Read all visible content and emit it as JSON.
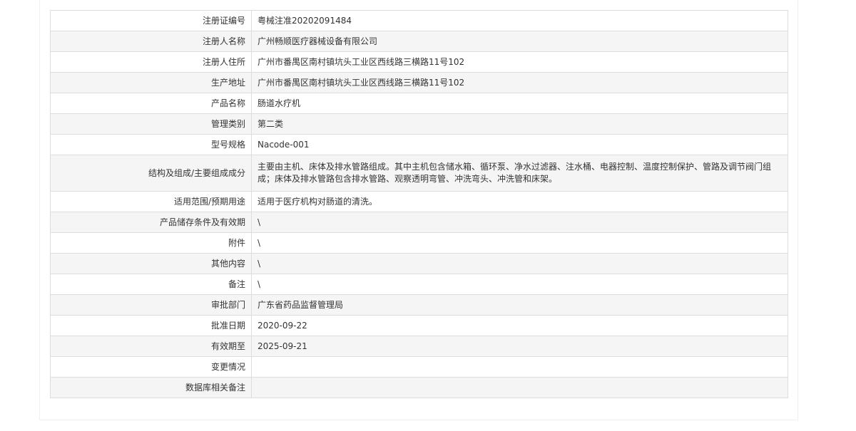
{
  "rows": [
    {
      "label": "注册证编号",
      "value": "粤械注准20202091484"
    },
    {
      "label": "注册人名称",
      "value": "广州畅顺医疗器械设备有限公司"
    },
    {
      "label": "注册人住所",
      "value": "广州市番禺区南村镇坑头工业区西线路三横路11号102"
    },
    {
      "label": "生产地址",
      "value": "广州市番禺区南村镇坑头工业区西线路三横路11号102"
    },
    {
      "label": "产品名称",
      "value": "肠道水疗机"
    },
    {
      "label": "管理类别",
      "value": "第二类"
    },
    {
      "label": "型号规格",
      "value": "Nacode-001"
    },
    {
      "label": "结构及组成/主要组成成分",
      "value": "主要由主机、床体及排水管路组成。其中主机包含储水箱、循环泵、净水过滤器、注水桶、电器控制、温度控制保护、管路及调节阀门组成；床体及排水管路包含排水管路、观察透明弯管、冲洗弯头、冲洗管和床架。"
    },
    {
      "label": "适用范围/预期用途",
      "value": "适用于医疗机构对肠道的清洗。"
    },
    {
      "label": "产品储存条件及有效期",
      "value": "\\"
    },
    {
      "label": "附件",
      "value": "\\"
    },
    {
      "label": "其他内容",
      "value": "\\"
    },
    {
      "label": "备注",
      "value": "\\"
    },
    {
      "label": "审批部门",
      "value": "广东省药品监督管理局"
    },
    {
      "label": "批准日期",
      "value": "2020-09-22"
    },
    {
      "label": "有效期至",
      "value": "2025-09-21"
    },
    {
      "label": "变更情况",
      "value": ""
    },
    {
      "label": "数据库相关备注",
      "value": ""
    }
  ]
}
